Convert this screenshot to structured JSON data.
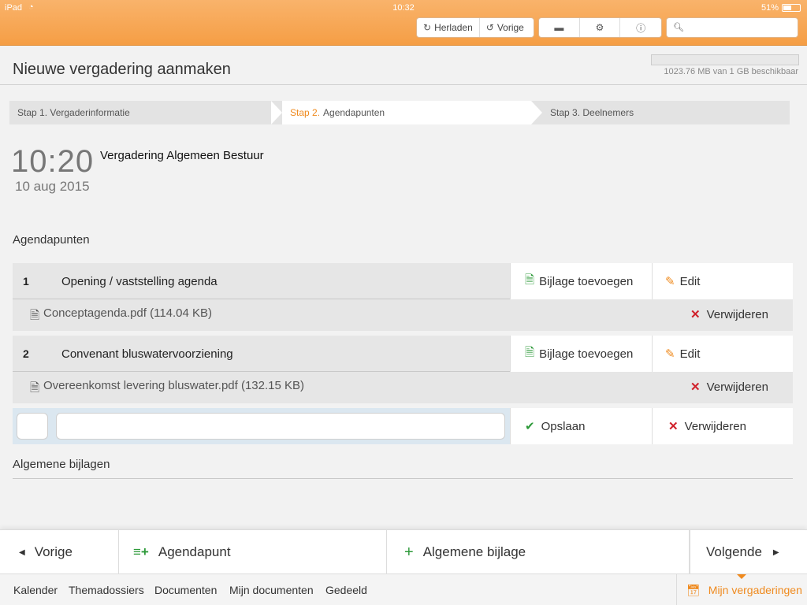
{
  "status_bar": {
    "carrier": "iPad",
    "time": "10:32",
    "battery": "51%"
  },
  "toolbar": {
    "reload_label": "Herladen",
    "previous_label": "Vorige",
    "search_placeholder": ""
  },
  "page": {
    "title": "Nieuwe vergadering aanmaken",
    "storage_text": "1023.76 MB van 1 GB beschikbaar"
  },
  "steps": [
    {
      "prefix": "Stap 1.",
      "label": "Vergaderinformatie"
    },
    {
      "prefix": "Stap 2.",
      "label": "Agendapunten"
    },
    {
      "prefix": "Stap 3.",
      "label": "Deelnemers"
    }
  ],
  "meeting": {
    "time": "10:20",
    "date": "10 aug 2015",
    "name": "Vergadering Algemeen Bestuur"
  },
  "agenda_heading": "Agendapunten",
  "agenda_items": [
    {
      "number": "1",
      "title": "Opening / vaststelling agenda",
      "attach_label": "Bijlage toevoegen",
      "edit_label": "Edit",
      "attachment": {
        "file": "Conceptagenda.pdf (114.04 KB)",
        "delete_label": "Verwijderen"
      }
    },
    {
      "number": "2",
      "title": "Convenant bluswatervoorziening",
      "attach_label": "Bijlage toevoegen",
      "edit_label": "Edit",
      "attachment": {
        "file": "Overeenkomst levering bluswater.pdf (132.15 KB)",
        "delete_label": "Verwijderen"
      }
    }
  ],
  "new_item": {
    "number_value": "",
    "title_value": "",
    "save_label": "Opslaan",
    "delete_label": "Verwijderen"
  },
  "general_heading": "Algemene bijlagen",
  "action_bar": {
    "prev_label": "Vorige",
    "add_agenda_label": "Agendapunt",
    "add_general_label": "Algemene bijlage",
    "next_label": "Volgende"
  },
  "bottom_nav": {
    "items": [
      "Kalender",
      "Themadossiers",
      "Documenten",
      "Mijn documenten",
      "Gedeeld"
    ],
    "active": "Mijn vergaderingen"
  },
  "colors": {
    "accent": "#ef8a1e",
    "toolbar_bg": "#f59e45",
    "green": "#2e9a3a",
    "red": "#d0202a"
  }
}
